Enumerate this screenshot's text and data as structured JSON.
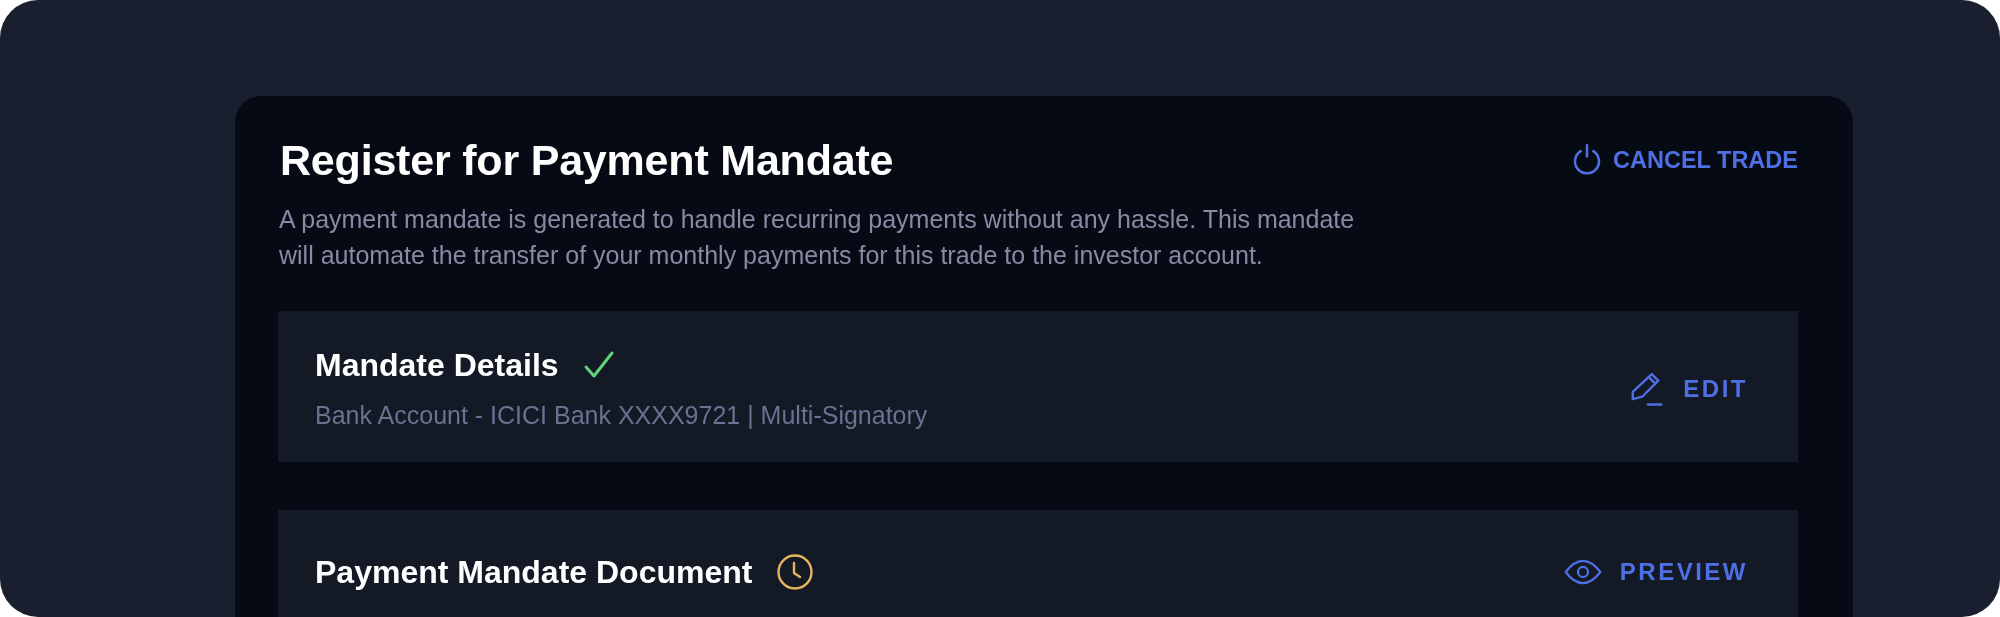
{
  "header": {
    "title": "Register for Payment Mandate",
    "description": "A payment mandate is generated to handle recurring payments without any hassle. This mandate will automate the transfer of your monthly payments for this trade to the investor account.",
    "action": {
      "label": "CANCEL TRADE"
    }
  },
  "sections": [
    {
      "title": "Mandate Details",
      "complete": true,
      "subtitle": "Bank Account - ICICI Bank XXXX9721 | Multi-Signatory",
      "action": {
        "kind": "edit",
        "label": "EDIT"
      }
    },
    {
      "title": "Payment Mandate Document",
      "complete": false,
      "action": {
        "kind": "preview",
        "label": "PREVIEW"
      }
    }
  ]
}
